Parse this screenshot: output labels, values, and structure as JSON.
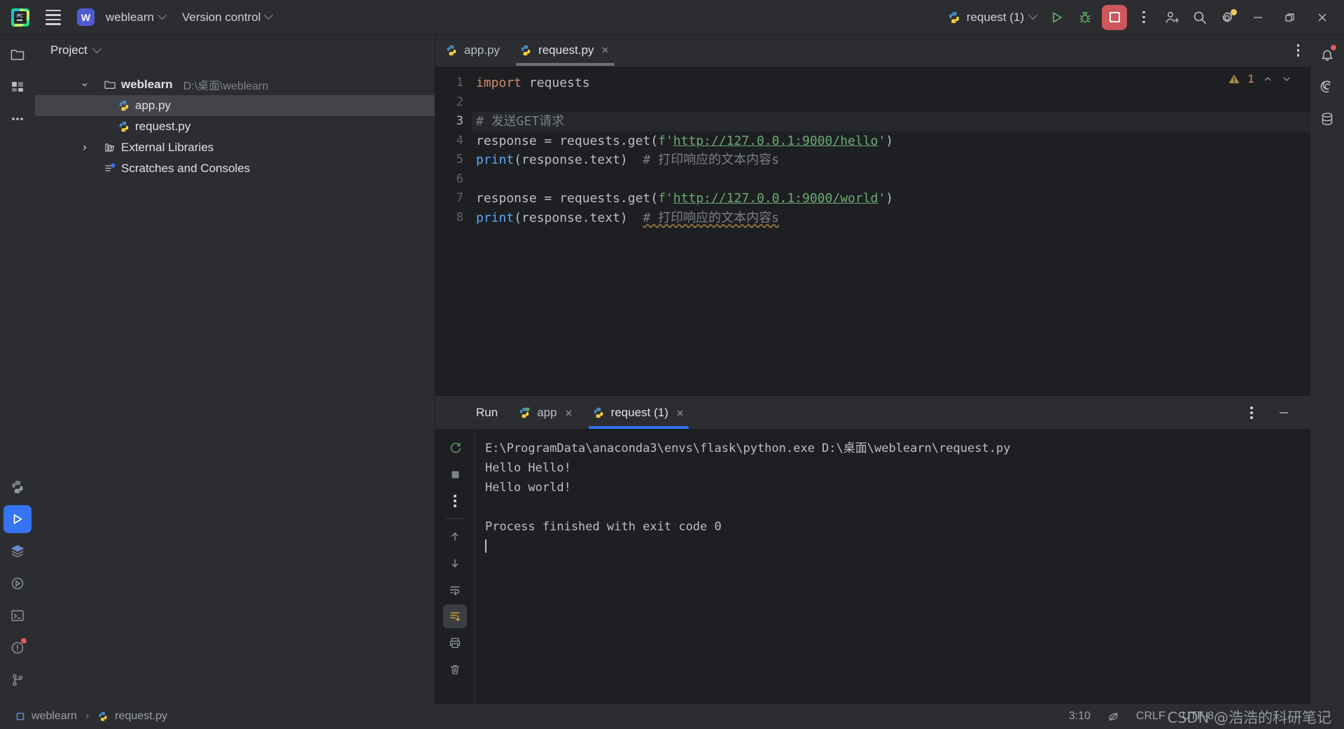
{
  "titlebar": {
    "app_icon": "pycharm-logo-icon",
    "menu_icon": "hamburger-menu-icon",
    "project_badge": "W",
    "project_name": "weblearn",
    "version_control_label": "Version control",
    "run_config_name": "request (1)",
    "run_icon": "run-triangle-icon",
    "debug_icon": "debug-bug-icon",
    "stop_icon": "stop-square-icon",
    "more_icon": "more-vertical-icon",
    "add_user_icon": "add-user-icon",
    "search_icon": "search-icon",
    "settings_icon": "gear-icon",
    "minimize_icon": "minimize-icon",
    "maximize_icon": "maximize-restore-icon",
    "close_icon": "close-icon"
  },
  "left_rail": [
    {
      "name": "project-tool-window",
      "icon": "folder-icon",
      "active": false
    },
    {
      "name": "commit-tool-window",
      "icon": "commit-icon",
      "active": false
    },
    {
      "name": "more-tool-windows",
      "icon": "ellipsis-icon",
      "active": false
    }
  ],
  "left_rail_bottom": [
    {
      "name": "python-packages",
      "icon": "python-icon",
      "active": false
    },
    {
      "name": "run-tool-window",
      "icon": "run-triangle-icon",
      "active": true
    },
    {
      "name": "python-packages-window",
      "icon": "layers-icon",
      "active": false
    },
    {
      "name": "python-console",
      "icon": "python-console-icon",
      "active": false
    },
    {
      "name": "terminal",
      "icon": "terminal-icon",
      "active": false
    },
    {
      "name": "problems",
      "icon": "problems-icon",
      "active": false,
      "badge": true
    },
    {
      "name": "version-control-branch",
      "icon": "branch-icon",
      "active": false
    }
  ],
  "right_rail": [
    {
      "name": "notifications",
      "icon": "bell-icon",
      "badge": true
    },
    {
      "name": "ai-assistant",
      "icon": "ai-spiral-icon",
      "badge": false
    },
    {
      "name": "database",
      "icon": "database-icon",
      "badge": false
    }
  ],
  "project_panel": {
    "title": "Project",
    "title_chevron": "chevron-down-icon",
    "tree": [
      {
        "name": "weblearn",
        "path": "D:\\桌面\\weblearn",
        "icon": "folder-icon",
        "expanded": true,
        "level": 0,
        "selected": false,
        "bold": true
      },
      {
        "name": "app.py",
        "path": "",
        "icon": "python-file-icon",
        "expanded": null,
        "level": 1,
        "selected": true,
        "bold": false
      },
      {
        "name": "request.py",
        "path": "",
        "icon": "python-file-icon",
        "expanded": null,
        "level": 1,
        "selected": false,
        "bold": false
      },
      {
        "name": "External Libraries",
        "path": "",
        "icon": "library-icon",
        "expanded": false,
        "level": 0,
        "selected": false,
        "bold": false
      },
      {
        "name": "Scratches and Consoles",
        "path": "",
        "icon": "scratches-icon",
        "expanded": null,
        "level": 0,
        "selected": false,
        "bold": false
      }
    ]
  },
  "editor": {
    "tabs": [
      {
        "label": "app.py",
        "icon": "python-file-icon",
        "active": false,
        "closable": false
      },
      {
        "label": "request.py",
        "icon": "python-file-icon",
        "active": true,
        "closable": true
      }
    ],
    "options_icon": "more-vertical-icon",
    "inspection": {
      "warning_icon": "warning-triangle-icon",
      "warning_count": "1",
      "prev_icon": "chevron-up-icon",
      "next_icon": "chevron-down-icon"
    },
    "current_line": 3,
    "lines": [
      {
        "no": "1",
        "tokens": [
          {
            "t": "kw",
            "v": "import"
          },
          {
            "t": "plain",
            "v": " requests"
          }
        ]
      },
      {
        "no": "2",
        "tokens": []
      },
      {
        "no": "3",
        "tokens": [
          {
            "t": "cmt",
            "v": "# 发送GET请求"
          }
        ]
      },
      {
        "no": "4",
        "tokens": [
          {
            "t": "plain",
            "v": "response = requests.get("
          },
          {
            "t": "str",
            "v": "f'"
          },
          {
            "t": "strlink",
            "v": "http://127.0.0.1:9000/hello"
          },
          {
            "t": "str",
            "v": "'"
          },
          {
            "t": "plain",
            "v": ")"
          }
        ]
      },
      {
        "no": "5",
        "tokens": [
          {
            "t": "fn",
            "v": "print"
          },
          {
            "t": "plain",
            "v": "(response.text)  "
          },
          {
            "t": "cmt",
            "v": "# 打印响应的文本内容s"
          }
        ]
      },
      {
        "no": "6",
        "tokens": []
      },
      {
        "no": "7",
        "tokens": [
          {
            "t": "plain",
            "v": "response = requests.get("
          },
          {
            "t": "str",
            "v": "f'"
          },
          {
            "t": "strlink",
            "v": "http://127.0.0.1:9000/world"
          },
          {
            "t": "str",
            "v": "'"
          },
          {
            "t": "plain",
            "v": ")"
          }
        ]
      },
      {
        "no": "8",
        "tokens": [
          {
            "t": "fn",
            "v": "print"
          },
          {
            "t": "plain",
            "v": "(response.text)  "
          },
          {
            "t": "cmtwarn",
            "v": "# 打印响应的文本内容s"
          }
        ]
      }
    ]
  },
  "run_panel": {
    "title": "Run",
    "tabs": [
      {
        "label": "app",
        "icon": "python-running-icon",
        "active": false
      },
      {
        "label": "request (1)",
        "icon": "python-file-icon",
        "active": true
      }
    ],
    "options_icon": "more-vertical-icon",
    "minimize_icon": "minimize-icon",
    "toolbar": [
      {
        "name": "rerun-button",
        "icon": "rerun-icon"
      },
      {
        "name": "stop-button",
        "icon": "stop-square-icon"
      },
      {
        "name": "more-options-button",
        "icon": "more-vertical-icon"
      },
      {
        "name": "scroll-up-button",
        "icon": "arrow-up-icon"
      },
      {
        "name": "scroll-down-button",
        "icon": "arrow-down-icon"
      },
      {
        "name": "soft-wrap-button",
        "icon": "soft-wrap-icon"
      },
      {
        "name": "scroll-to-end-button",
        "icon": "scroll-to-end-icon"
      },
      {
        "name": "print-button",
        "icon": "printer-icon"
      },
      {
        "name": "clear-all-button",
        "icon": "trash-icon"
      }
    ],
    "console_lines": [
      "E:\\ProgramData\\anaconda3\\envs\\flask\\python.exe D:\\桌面\\weblearn\\request.py",
      "Hello Hello!",
      "Hello world!",
      "",
      "Process finished with exit code 0"
    ]
  },
  "statusbar": {
    "breadcrumb_project": "weblearn",
    "breadcrumb_file": "request.py",
    "breadcrumb_separator": "›",
    "caret_position": "3:10",
    "indent_icon": "no-indent-icon",
    "line_separator": "CRLF",
    "encoding": "UTF-8",
    "watermark": "CSDN @浩浩的科研笔记"
  },
  "colors": {
    "bg_editor": "#1e1f22",
    "bg_panel": "#2b2d30",
    "accent_blue": "#3573f0",
    "accent_red": "#cf5659",
    "accent_green": "#499c54",
    "keyword_orange": "#cf8e6d",
    "string_green": "#6aab73",
    "function_blue": "#56a8f5",
    "comment_gray": "#7a7e85",
    "warning_yellow": "#f2c55c"
  }
}
